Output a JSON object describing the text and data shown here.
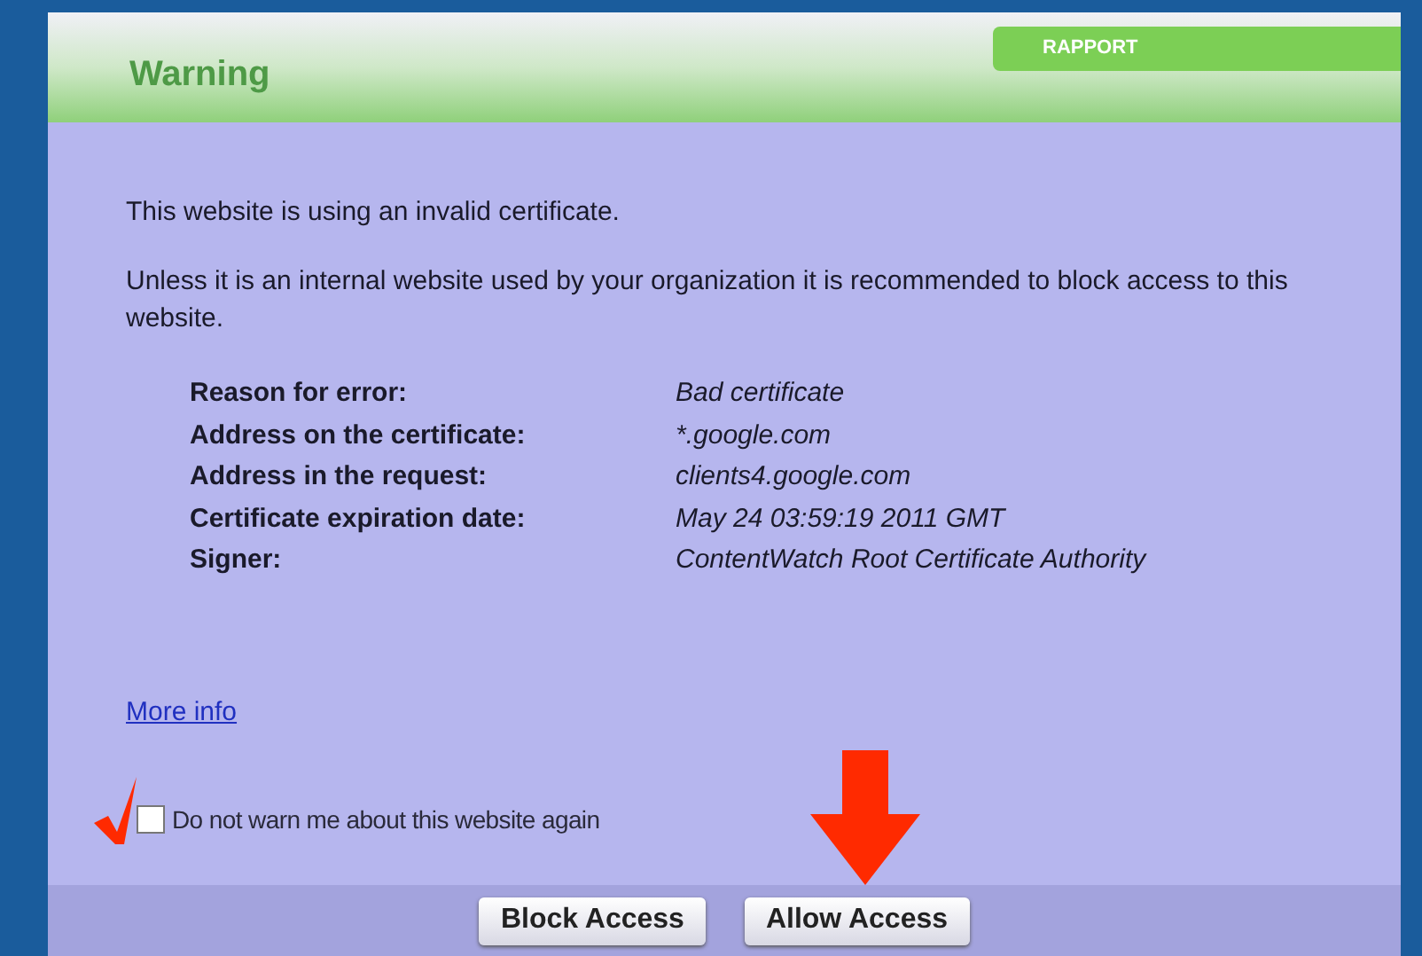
{
  "dialog": {
    "title": "Warning",
    "badge": "RAPPORT"
  },
  "paragraphs": [
    "This website is using an invalid certificate.",
    "Unless it is an internal website used by your organization it is recommended to block access to this website."
  ],
  "details": [
    {
      "label": "Reason for error:",
      "value": "Bad certificate"
    },
    {
      "label": "Address on the certificate:",
      "value": "*.google.com"
    },
    {
      "label": "Address in the request:",
      "value": "clients4.google.com"
    },
    {
      "label": "Certificate expiration date:",
      "value": "May 24 03:59:19 2011 GMT"
    },
    {
      "label": "Signer:",
      "value": "ContentWatch Root Certificate Authority"
    }
  ],
  "more_info_link": "More info",
  "checkbox": {
    "label": "Do not warn me about this website again",
    "checked": false
  },
  "buttons": [
    "Block Access",
    "Allow Access"
  ]
}
